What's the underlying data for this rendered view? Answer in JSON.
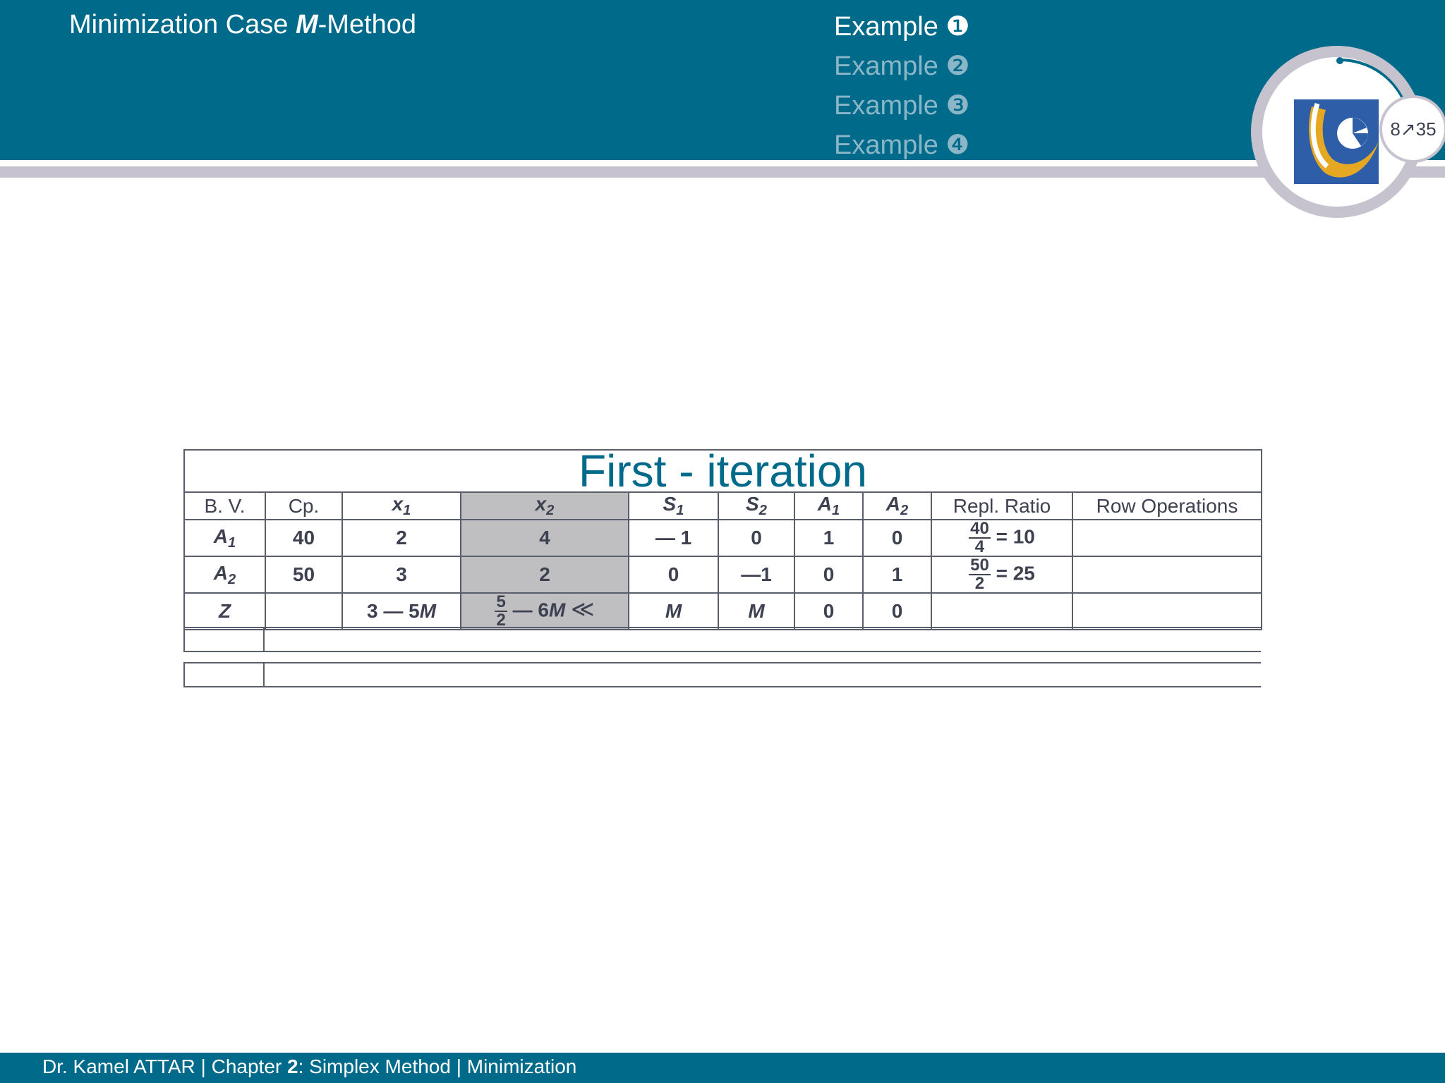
{
  "header": {
    "title_prefix": "Minimization Case ",
    "title_italic": "M",
    "title_suffix": "-Method",
    "nav": [
      {
        "label": "Example ❶",
        "active": true
      },
      {
        "label": "Example ❷",
        "active": false
      },
      {
        "label": "Example ❸",
        "active": false
      },
      {
        "label": "Example ❹",
        "active": false
      }
    ],
    "page_current": "8",
    "page_arrow": "↗",
    "page_total": "35",
    "logo_icon": "university-logo-icon"
  },
  "tableau": {
    "caption": "First - iteration",
    "headers": {
      "bv": "B. V.",
      "cp": "Cp.",
      "x1": "x",
      "x1_sub": "1",
      "x2": "x",
      "x2_sub": "2",
      "s1": "S",
      "s1_sub": "1",
      "s2": "S",
      "s2_sub": "2",
      "a1": "A",
      "a1_sub": "1",
      "a2": "A",
      "a2_sub": "2",
      "ratio": "Repl. Ratio",
      "ops": "Row Operations"
    },
    "rows": [
      {
        "bv": "A",
        "bv_sub": "1",
        "cp": "40",
        "x1": "2",
        "x2": "4",
        "s1": "— 1",
        "s2": "0",
        "a1": "1",
        "a2": "0",
        "ratio_num": "40",
        "ratio_den": "4",
        "ratio_result": "= 10"
      },
      {
        "bv": "A",
        "bv_sub": "2",
        "cp": "50",
        "x1": "3",
        "x2": "2",
        "s1": "0",
        "s2": "—1",
        "a1": "0",
        "a2": "1",
        "ratio_num": "50",
        "ratio_den": "2",
        "ratio_result": "= 25"
      }
    ],
    "z_row": {
      "bv": "Z",
      "x1_num": "3 — 5",
      "x1_m": "M",
      "x2_num": "5",
      "x2_den": "2",
      "x2_rest": " — 6",
      "x2_m": "M",
      "x2_arrow": "≪",
      "s1": "M",
      "s2": "M",
      "a1": "0",
      "a2": "0"
    },
    "pivot_column_color": "#bfbfc1"
  },
  "footer": {
    "author": "Dr. Kamel ATTAR | Chapter ",
    "chapter": "2",
    "rest": ": Simplex Method | Minimization"
  },
  "colors": {
    "primary": "#006a8a",
    "accent_grey": "#c6c3cf",
    "logo_blue": "#2f5ea8",
    "logo_gold": "#e6a823"
  }
}
